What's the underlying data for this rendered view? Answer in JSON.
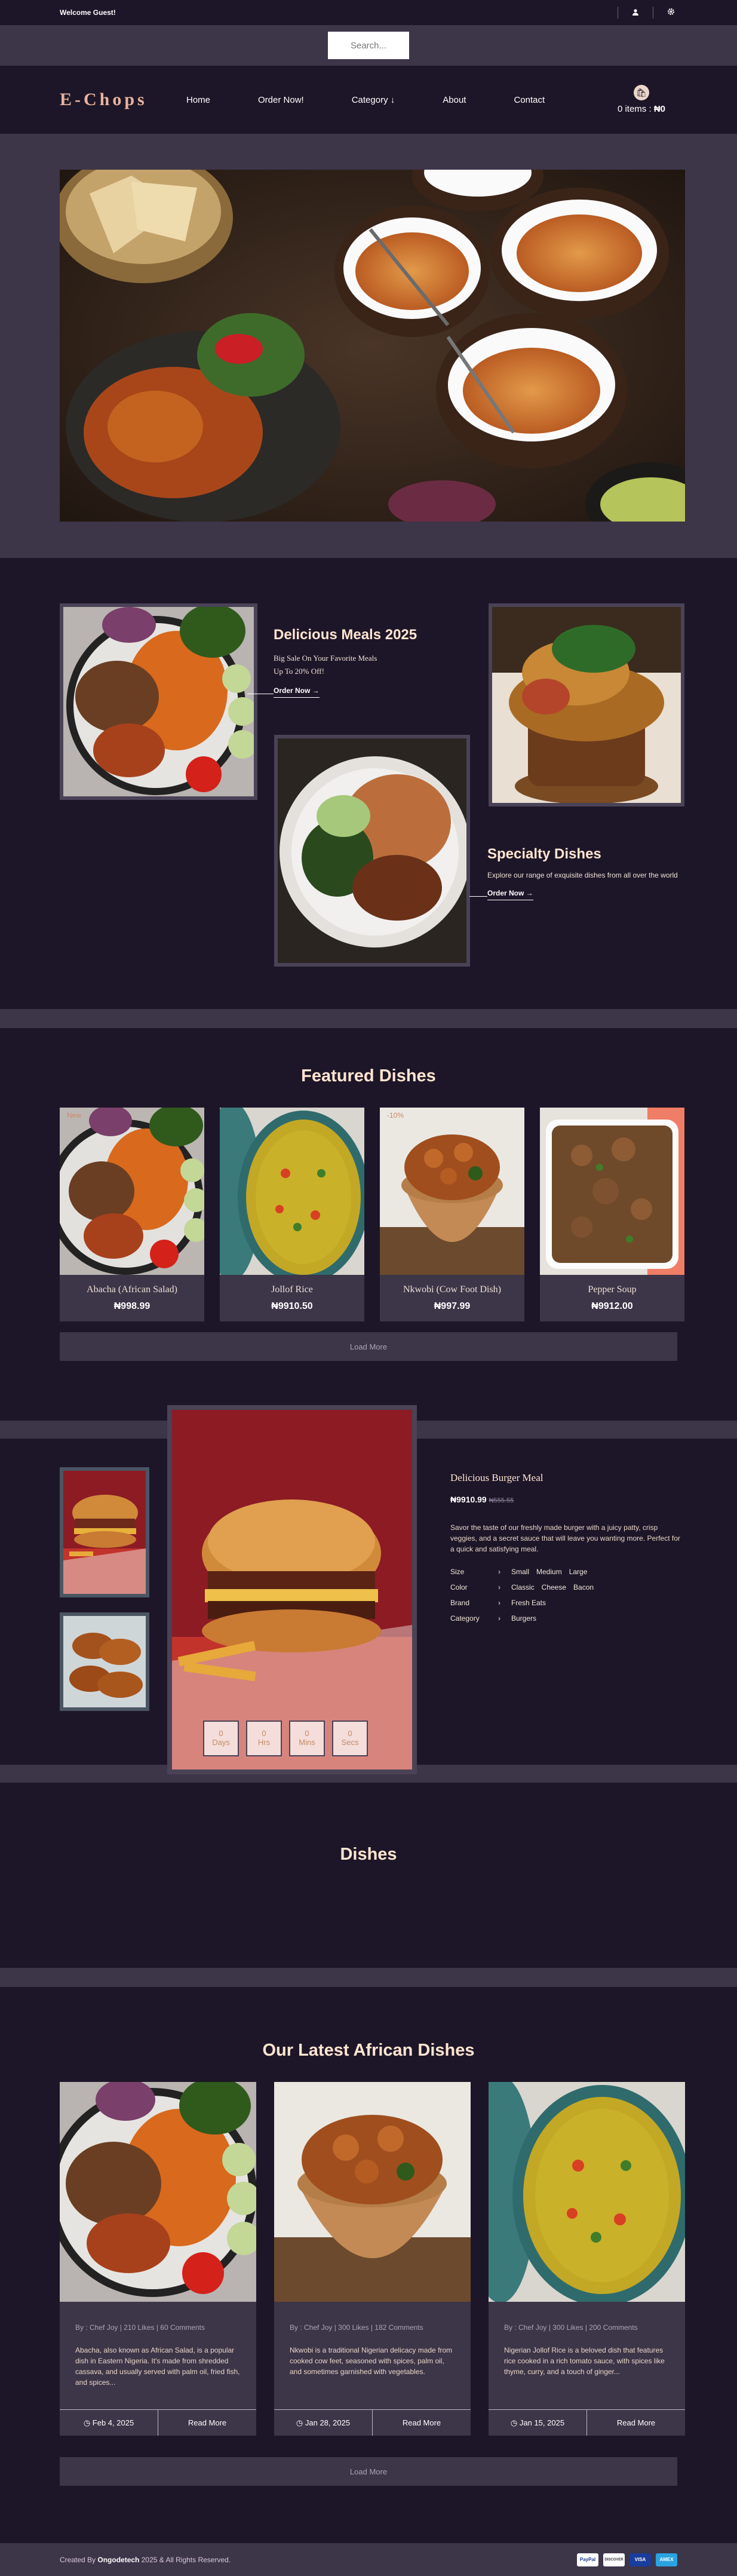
{
  "topbar": {
    "welcome": "Welcome Guest!",
    "user_icon": "user-icon",
    "settings_icon": "gear-icon"
  },
  "search": {
    "placeholder": "Search..."
  },
  "nav": {
    "logo": "E-Chops",
    "links": [
      "Home",
      "Order Now!",
      "Category",
      "About",
      "Contact"
    ],
    "category_caret": "↓",
    "cart": {
      "items_label": "0 items",
      "amount": "₦0"
    }
  },
  "promo": {
    "block1": {
      "title": "Delicious Meals 2025",
      "line1": "Big Sale On Your Favorite Meals",
      "line2": "Up To 20% Off!",
      "cta": "Order Now →"
    },
    "block2": {
      "title": "Specialty Dishes",
      "text": "Explore our range of exquisite dishes from all over the world",
      "cta": "Order Now →"
    }
  },
  "featured": {
    "title": "Featured Dishes",
    "cards": [
      {
        "badge": "New",
        "name": "Abacha (African Salad)",
        "price": "₦998.99"
      },
      {
        "badge": "",
        "name": "Jollof Rice",
        "price": "₦9910.50"
      },
      {
        "badge": "-10%",
        "name": "Nkwobi (Cow Foot Dish)",
        "price": "₦997.99"
      },
      {
        "badge": "",
        "name": "Pepper Soup",
        "price": "₦9912.00"
      }
    ],
    "load_more": "Load More"
  },
  "product": {
    "name": "Delicious Burger Meal",
    "price": "₦9910.99",
    "old_price": "₦555.55",
    "description": "Savor the taste of our freshly made burger with a juicy patty, crisp veggies, and a secret sauce that will leave you wanting more. Perfect for a quick and satisfying meal.",
    "specs": [
      {
        "label": "Size",
        "values": [
          "Small",
          "Medium",
          "Large"
        ]
      },
      {
        "label": "Color",
        "values": [
          "Classic",
          "Cheese",
          "Bacon"
        ]
      },
      {
        "label": "Brand",
        "values": [
          "Fresh Eats"
        ]
      },
      {
        "label": "Category",
        "values": [
          "Burgers"
        ]
      }
    ],
    "countdown": [
      {
        "value": "0",
        "unit": "Days"
      },
      {
        "value": "0",
        "unit": "Hrs"
      },
      {
        "value": "0",
        "unit": "Mins"
      },
      {
        "value": "0",
        "unit": "Secs"
      }
    ]
  },
  "dishes": {
    "title": "Dishes"
  },
  "latest": {
    "title": "Our Latest African Dishes",
    "posts": [
      {
        "meta": "By : Chef Joy | 210 Likes | 60 Comments",
        "text": "Abacha, also known as African Salad, is a popular dish in Eastern Nigeria. It's made from shredded cassava, and usually served with palm oil, fried fish, and spices...",
        "date": "◷ Feb 4, 2025",
        "cta": "Read More"
      },
      {
        "meta": "By : Chef Joy | 300 Likes | 182 Comments",
        "text": "Nkwobi is a traditional Nigerian delicacy made from cooked cow feet, seasoned with spices, palm oil, and sometimes garnished with vegetables.",
        "date": "◷ Jan 28, 2025",
        "cta": "Read More"
      },
      {
        "meta": "By : Chef Joy | 300 Likes | 200 Comments",
        "text": "Nigerian Jollof Rice is a beloved dish that features rice cooked in a rich tomato sauce, with spices like thyme, curry, and a touch of ginger...",
        "date": "◷ Jan 15, 2025",
        "cta": "Read More"
      }
    ],
    "load_more": "Load More"
  },
  "footer": {
    "prefix": "Created By",
    "author": "Ongodetech",
    "suffix": "2025 & All Rights Reserved.",
    "payments": [
      "PayPal",
      "DISCOVER",
      "VISA",
      "AMEX"
    ]
  }
}
